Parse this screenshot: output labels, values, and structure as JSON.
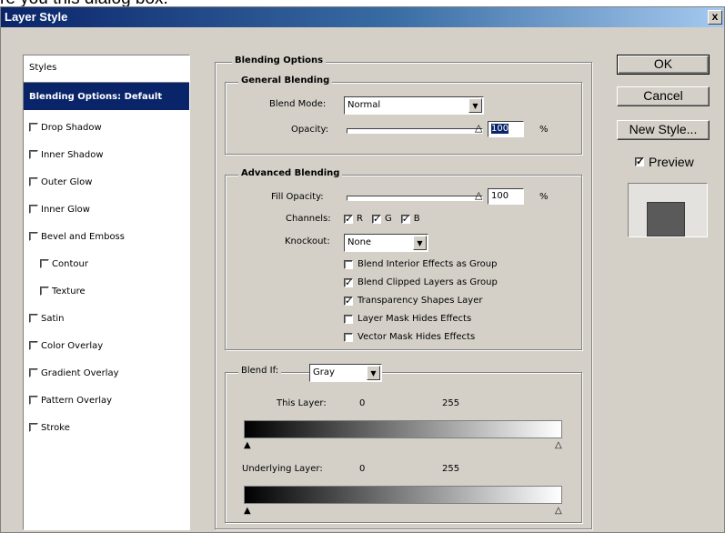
{
  "caption": "re you this dialog box.",
  "window": {
    "title": "Layer Style",
    "close": "x"
  },
  "styles_panel": {
    "header": "Styles",
    "items": [
      {
        "label": "Blending Options: Default",
        "selected": true,
        "checkbox": false,
        "checked": false,
        "indent": false
      },
      {
        "label": "Drop Shadow",
        "selected": false,
        "checkbox": true,
        "checked": false,
        "indent": false
      },
      {
        "label": "Inner Shadow",
        "selected": false,
        "checkbox": true,
        "checked": false,
        "indent": false
      },
      {
        "label": "Outer Glow",
        "selected": false,
        "checkbox": true,
        "checked": false,
        "indent": false
      },
      {
        "label": "Inner Glow",
        "selected": false,
        "checkbox": true,
        "checked": false,
        "indent": false
      },
      {
        "label": "Bevel and Emboss",
        "selected": false,
        "checkbox": true,
        "checked": false,
        "indent": false
      },
      {
        "label": "Contour",
        "selected": false,
        "checkbox": true,
        "checked": false,
        "indent": true
      },
      {
        "label": "Texture",
        "selected": false,
        "checkbox": true,
        "checked": false,
        "indent": true
      },
      {
        "label": "Satin",
        "selected": false,
        "checkbox": true,
        "checked": false,
        "indent": false
      },
      {
        "label": "Color Overlay",
        "selected": false,
        "checkbox": true,
        "checked": false,
        "indent": false
      },
      {
        "label": "Gradient Overlay",
        "selected": false,
        "checkbox": true,
        "checked": false,
        "indent": false
      },
      {
        "label": "Pattern Overlay",
        "selected": false,
        "checkbox": true,
        "checked": false,
        "indent": false
      },
      {
        "label": "Stroke",
        "selected": false,
        "checkbox": true,
        "checked": false,
        "indent": false
      }
    ]
  },
  "blending": {
    "title": "Blending Options",
    "general": {
      "title": "General Blending",
      "blend_mode_label": "Blend Mode:",
      "blend_mode_value": "Normal",
      "opacity_label": "Opacity:",
      "opacity_value": "100",
      "opacity_unit": "%",
      "opacity_fraction": 1.0
    },
    "advanced": {
      "title": "Advanced Blending",
      "fill_opacity_label": "Fill Opacity:",
      "fill_opacity_value": "100",
      "fill_opacity_unit": "%",
      "fill_opacity_fraction": 1.0,
      "channels_label": "Channels:",
      "channels": [
        {
          "label": "R",
          "checked": true
        },
        {
          "label": "G",
          "checked": true
        },
        {
          "label": "B",
          "checked": true
        }
      ],
      "knockout_label": "Knockout:",
      "knockout_value": "None",
      "options": [
        {
          "label": "Blend Interior Effects as Group",
          "checked": false
        },
        {
          "label": "Blend Clipped Layers as Group",
          "checked": true
        },
        {
          "label": "Transparency Shapes Layer",
          "checked": true
        },
        {
          "label": "Layer Mask Hides Effects",
          "checked": false
        },
        {
          "label": "Vector Mask Hides Effects",
          "checked": false
        }
      ]
    },
    "blend_if": {
      "label": "Blend If:",
      "value": "Gray",
      "this_layer_label": "This Layer:",
      "this_layer_min": "0",
      "this_layer_max": "255",
      "underlying_label": "Underlying Layer:",
      "underlying_min": "0",
      "underlying_max": "255"
    }
  },
  "buttons": {
    "ok": "OK",
    "cancel": "Cancel",
    "new_style": "New Style...",
    "preview_label": "Preview",
    "preview_checked": true
  },
  "icons": {
    "dropdown": "chevron-down-icon",
    "slider_thumb": "triangle-up-icon"
  },
  "colors": {
    "title_bar": "#0a246a",
    "selection": "#0a246a",
    "dialog_bg": "#d4d0c8"
  }
}
